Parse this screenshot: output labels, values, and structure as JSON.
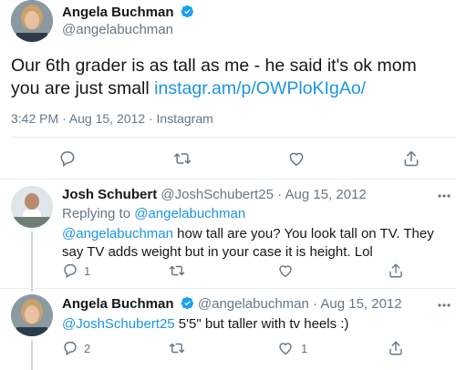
{
  "main_tweet": {
    "author_name": "Angela Buchman",
    "author_handle": "@angelabuchman",
    "text_before_link": "Our 6th grader is as tall as me - he said it's ok mom you are just small ",
    "link_text": "instagr.am/p/OWPloKIgAo/",
    "meta": "3:42 PM · Aug 15, 2012 · Instagram",
    "icons": [
      "reply-icon",
      "retweet-icon",
      "like-icon",
      "share-icon"
    ]
  },
  "replies": [
    {
      "author_name": "Josh Schubert",
      "author_handle": "@JoshSchubert25",
      "date": "· Aug 15, 2012",
      "replying_label": "Replying to ",
      "replying_handle": "@angelabuchman",
      "mention": "@angelabuchman",
      "text": " how tall are you? You look tall on TV. They say TV adds weight but in your case it is height. Lol",
      "reply_count": "1",
      "like_count": ""
    },
    {
      "author_name": "Angela Buchman",
      "author_handle": "@angelabuchman",
      "date": "· Aug 15, 2012",
      "mention": "@JoshSchubert25",
      "text": " 5'5\" but taller with tv heels :)",
      "reply_count": "2",
      "like_count": "1"
    }
  ],
  "colors": {
    "link": "#1b95e0",
    "muted": "#657786",
    "verified": "#1da1f2",
    "divider": "#e6ecf0"
  }
}
